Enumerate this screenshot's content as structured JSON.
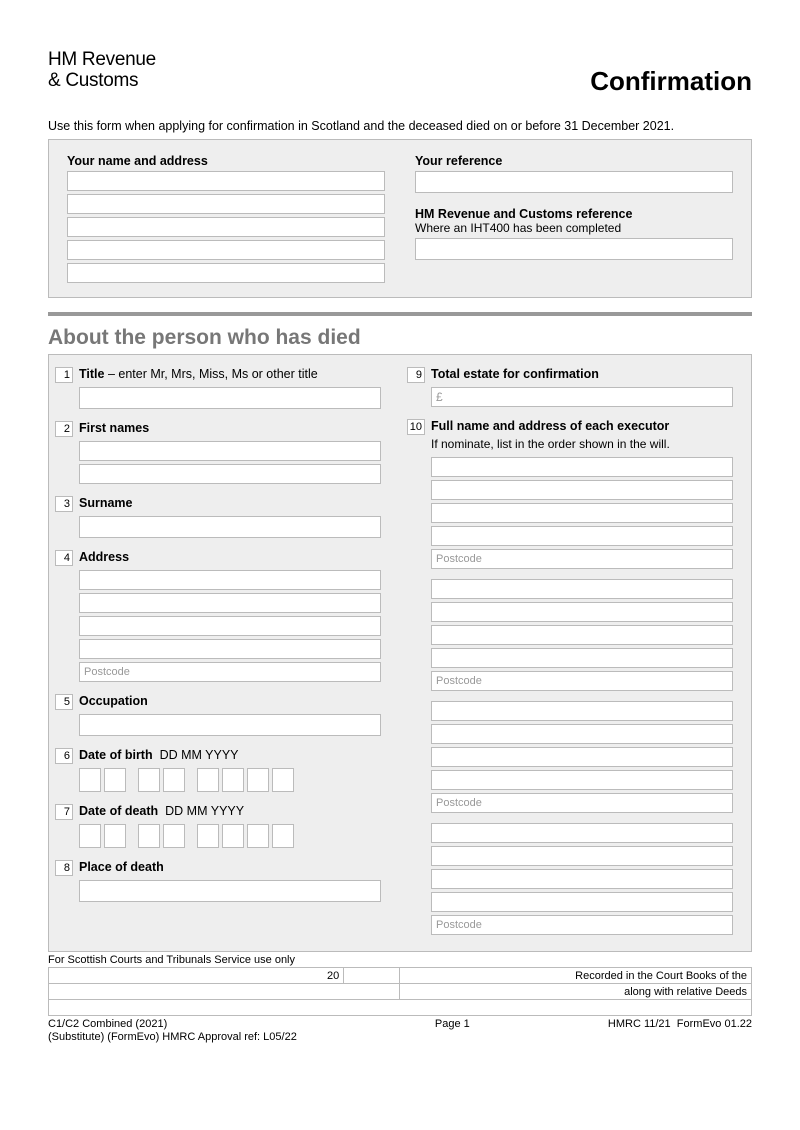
{
  "header": {
    "logo_line1": "HM Revenue",
    "logo_line2": "& Customs",
    "title": "Confirmation"
  },
  "intro": "Use this form when applying for confirmation in Scotland and the deceased died on or before 31 December 2021.",
  "top": {
    "name_address_label": "Your name and address",
    "reference_label": "Your reference",
    "hmrc_ref_label": "HM Revenue and Customs reference",
    "hmrc_ref_sub": "Where an IHT400 has been completed"
  },
  "section_title": "About the person who has died",
  "q": {
    "n1": "1",
    "title_label": "Title",
    "title_hint": " – enter Mr, Mrs, Miss, Ms or other title",
    "n2": "2",
    "first_names": "First names",
    "n3": "3",
    "surname": "Surname",
    "n4": "4",
    "address": "Address",
    "postcode": "Postcode",
    "n5": "5",
    "occupation": "Occupation",
    "n6": "6",
    "dob": "Date of birth",
    "date_hint": "DD MM YYYY",
    "n7": "7",
    "dod": "Date of death",
    "n8": "8",
    "place_of_death": "Place of death",
    "n9": "9",
    "total_estate": "Total estate for confirmation",
    "pound": "£",
    "n10": "10",
    "executors": "Full name and address of each executor",
    "executors_hint": "If nominate, list in the order shown in the will."
  },
  "court": {
    "label": "For Scottish Courts and Tribunals Service use only",
    "c20": "20",
    "recorded": "Recorded in the Court Books of the",
    "deeds": "along with relative Deeds"
  },
  "footer": {
    "l1": "C1/C2 Combined (2021)",
    "l2": "(Substitute) (FormEvo) HMRC Approval ref: L05/22",
    "page": "Page 1",
    "right1": "HMRC 11/21",
    "right2": "FormEvo 01.22"
  }
}
